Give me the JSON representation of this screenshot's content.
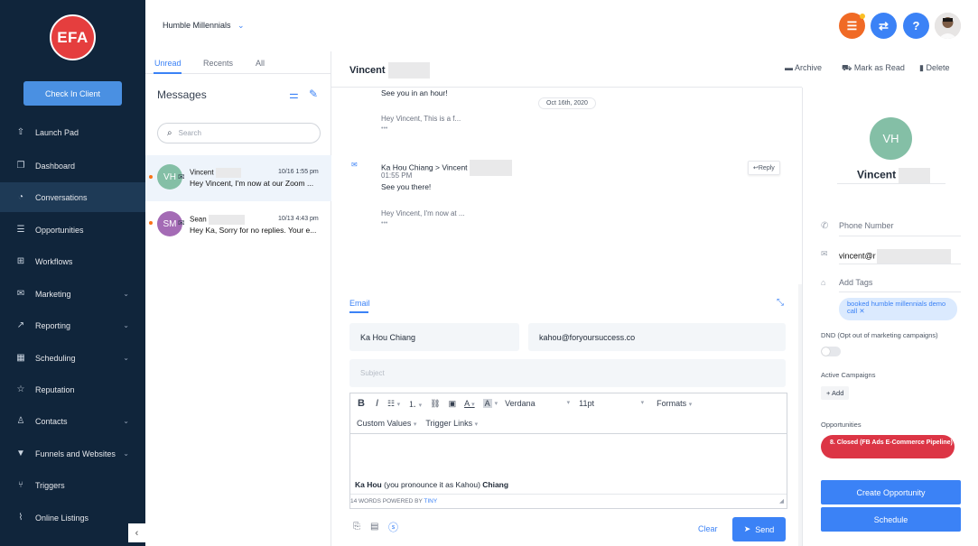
{
  "sidebar": {
    "logo_text": "EFA",
    "checkin_label": "Check In Client",
    "items": [
      {
        "label": "Launch Pad",
        "icon": "rocket-icon"
      },
      {
        "label": "Dashboard",
        "icon": "dashboard-icon"
      },
      {
        "label": "Conversations",
        "icon": "chat-icon"
      },
      {
        "label": "Opportunities",
        "icon": "opportunities-icon"
      },
      {
        "label": "Workflows",
        "icon": "workflow-icon"
      },
      {
        "label": "Marketing",
        "icon": "mail-icon"
      },
      {
        "label": "Reporting",
        "icon": "chart-icon"
      },
      {
        "label": "Scheduling",
        "icon": "calendar-icon"
      },
      {
        "label": "Reputation",
        "icon": "star-icon"
      },
      {
        "label": "Contacts",
        "icon": "user-icon"
      },
      {
        "label": "Funnels and Websites",
        "icon": "funnel-icon"
      },
      {
        "label": "Triggers",
        "icon": "trigger-icon"
      },
      {
        "label": "Online Listings",
        "icon": "listings-icon"
      }
    ],
    "collapse_glyph": "‹"
  },
  "topbar": {
    "account_name": "Humble Millennials"
  },
  "messages": {
    "tabs": [
      "Unread",
      "Recents",
      "All"
    ],
    "title": "Messages",
    "search_placeholder": "Search",
    "conversations": [
      {
        "initials": "VH",
        "name": "Vincent",
        "time": "10/16 1:55 pm",
        "preview": "Hey Vincent, I'm now at our Zoom ..."
      },
      {
        "initials": "SM",
        "name": "Sean",
        "time": "10/13 4:43 pm",
        "preview": "Hey Ka, Sorry for no replies. Your e..."
      }
    ]
  },
  "thread": {
    "contact_name": "Vincent",
    "actions": {
      "archive": "Archive",
      "mark_read": "Mark as Read",
      "delete": "Delete"
    },
    "msg1_text": "See you in an hour!",
    "date_chip": "Oct 16th, 2020",
    "collapsed1": "Hey Vincent, This is a f...",
    "ellipsis": "•••",
    "msg2_header": "Ka Hou Chiang > Vincent",
    "msg2_time": "01:55 PM",
    "msg2_text": "See you there!",
    "reply_label": "Reply",
    "collapsed2": "Hey Vincent, I'm now at ..."
  },
  "compose": {
    "tab": "Email",
    "from_name": "Ka Hou Chiang",
    "from_email": "kahou@foryoursuccess.co",
    "subject_placeholder": "Subject",
    "font": "Verdana",
    "size": "11pt",
    "formats": "Formats",
    "custom_values": "Custom Values",
    "trigger_links": "Trigger Links",
    "body_bold1": "Ka Hou",
    "body_mid": " (you pronounce it as Kahou) ",
    "body_bold2": "Chiang",
    "status_prefix": "14 WORDS POWERED BY",
    "status_link": "TINY",
    "clear": "Clear",
    "send": "Send"
  },
  "contact": {
    "initials": "VH",
    "name": "Vincent",
    "phone_placeholder": "Phone Number",
    "email_prefix": "vincent@r",
    "tags_placeholder": "Add Tags",
    "tag": "booked humble millennials demo call",
    "dnd_label": "DND (Opt out of marketing campaigns)",
    "campaigns_label": "Active Campaigns",
    "add_label": "+ Add",
    "opps_label": "Opportunities",
    "opp_pill": "8. Closed (FB Ads E-Commerce Pipeline)",
    "create_opp": "Create Opportunity",
    "schedule": "Schedule"
  }
}
